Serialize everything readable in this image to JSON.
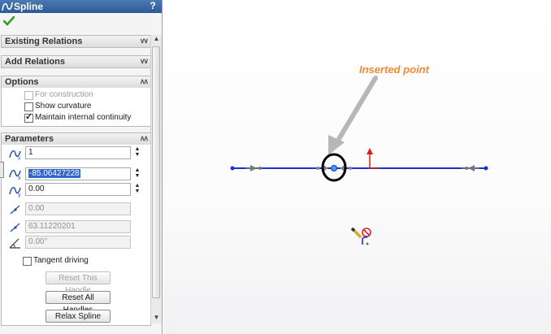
{
  "panel": {
    "title": "Spline",
    "help_label": "?",
    "groups": {
      "existing_relations": "Existing Relations",
      "add_relations": "Add Relations",
      "options": "Options",
      "parameters": "Parameters"
    },
    "options": {
      "for_construction": "For construction",
      "show_curvature": "Show curvature",
      "maintain_continuity": "Maintain internal continuity"
    },
    "parameters": {
      "point_number": "1",
      "x_coordinate": "-85.06427228",
      "y_coordinate": "0.00",
      "tangent_weight_1": "0.00",
      "tangent_weight_2": "63.11220201",
      "tangent_angle": "0.00°",
      "tangent_driving": "Tangent driving"
    },
    "buttons": {
      "reset_this_handle": "Reset This Handle",
      "reset_all_handles": "Reset All Handles",
      "relax_spline": "Relax Spline"
    }
  },
  "canvas": {
    "annotation": "Inserted point"
  },
  "colors": {
    "accent": "#2c5a96",
    "spline": "#1f2fd6",
    "annotation": "#f08a33",
    "axis_y": "#e01b1b"
  }
}
